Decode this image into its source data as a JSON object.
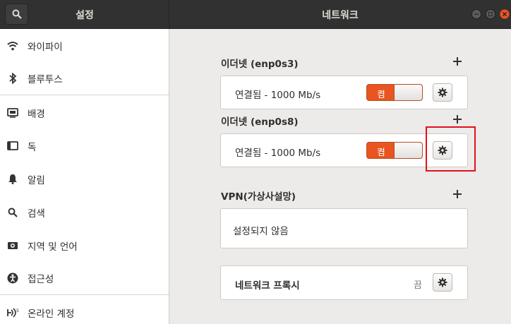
{
  "window": {
    "left_title": "설정",
    "main_title": "네트워크"
  },
  "sidebar": {
    "items": [
      {
        "label": "와이파이",
        "icon": "wifi-icon"
      },
      {
        "label": "블루투스",
        "icon": "bluetooth-icon"
      },
      {
        "label": "배경",
        "icon": "background-icon"
      },
      {
        "label": "독",
        "icon": "dock-icon"
      },
      {
        "label": "알림",
        "icon": "bell-icon"
      },
      {
        "label": "검색",
        "icon": "search-icon"
      },
      {
        "label": "지역 및 언어",
        "icon": "region-icon"
      },
      {
        "label": "접근성",
        "icon": "accessibility-icon"
      },
      {
        "label": "온라인 계정",
        "icon": "online-accounts-icon"
      }
    ]
  },
  "network": {
    "ethernet1": {
      "title": "이더넷 (enp0s3)",
      "status": "연결됨 - 1000 Mb/s",
      "toggle_label": "켬"
    },
    "ethernet2": {
      "title": "이더넷 (enp0s8)",
      "status": "연결됨 - 1000 Mb/s",
      "toggle_label": "켬"
    },
    "vpn": {
      "title": "VPN(가상사설망)",
      "status": "설정되지 않음"
    },
    "proxy": {
      "label": "네트워크 프록시",
      "status": "끔"
    }
  },
  "colors": {
    "accent": "#e95420",
    "highlight": "#e3101a",
    "header": "#313131"
  }
}
